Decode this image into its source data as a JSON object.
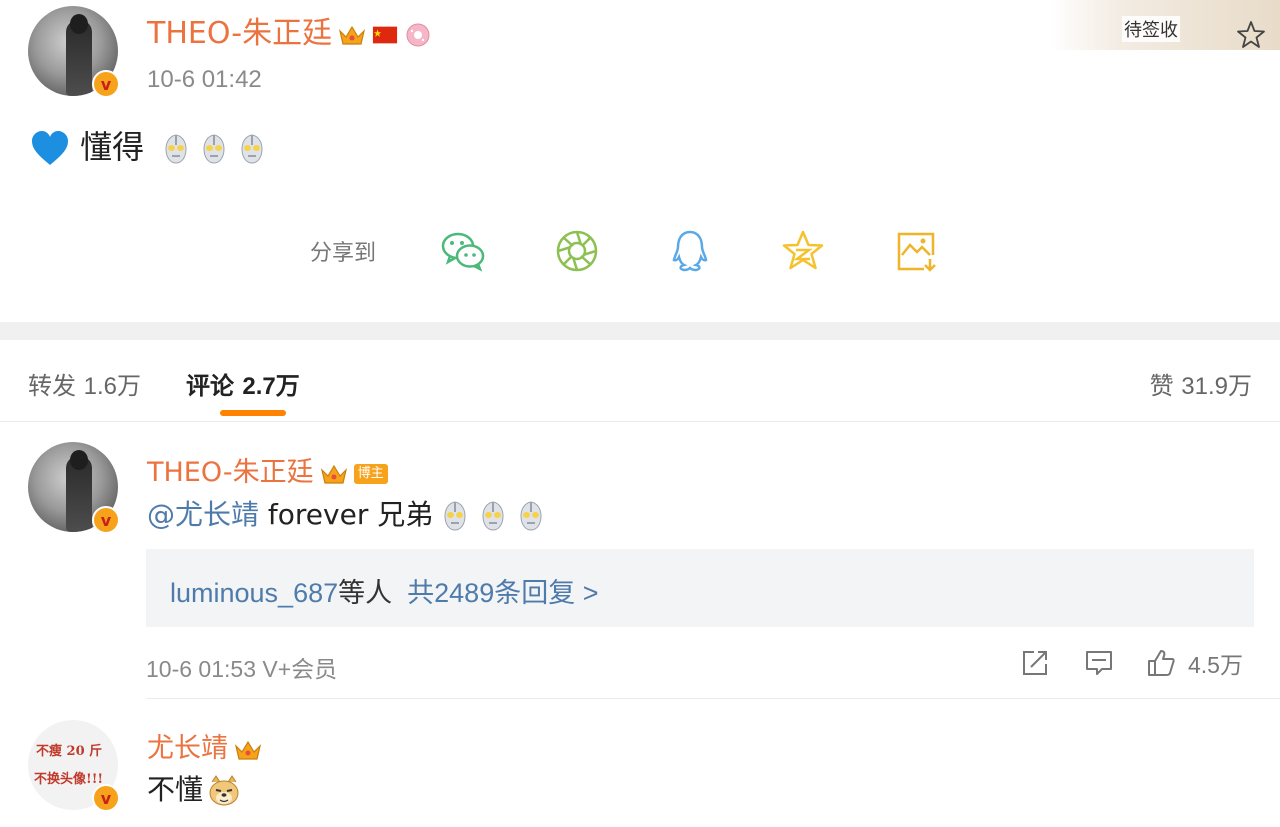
{
  "post": {
    "author": "THEO-朱正廷",
    "time": "10-6 01:42",
    "text": "懂得",
    "share_label": "分享到",
    "share_targets": [
      "wechat-icon",
      "moments-icon",
      "qq-icon",
      "qzone-icon",
      "save-image-icon"
    ]
  },
  "topright": {
    "label": "待签收"
  },
  "tabs": {
    "repost_label": "转发",
    "repost_count": "1.6万",
    "comment_label": "评论",
    "comment_count": "2.7万",
    "like_label": "赞",
    "like_count": "31.9万"
  },
  "comments": [
    {
      "author": "THEO-朱正廷",
      "badge": "博主",
      "mention": "@尤长靖",
      "text": " forever 兄弟",
      "replies_users": "luminous_687",
      "replies_mid": "等人",
      "replies_link": "共2489条回复 >",
      "time": "10-6 01:53",
      "client": "V+会员",
      "likes": "4.5万"
    },
    {
      "author": "尤长靖",
      "text": "不懂",
      "avatar_line1": "不瘦 20 斤",
      "avatar_line2": "不换头像!!!"
    }
  ],
  "colors": {
    "name": "#eb7340",
    "link": "#4f7bab",
    "accent": "#ff8200",
    "vip": "#f7a21b"
  }
}
